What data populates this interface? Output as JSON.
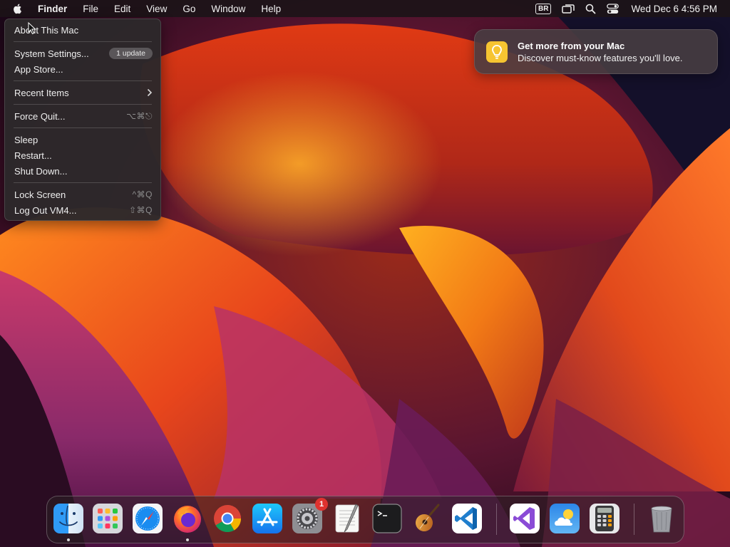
{
  "menubar": {
    "app_name": "Finder",
    "items": [
      "File",
      "Edit",
      "View",
      "Go",
      "Window",
      "Help"
    ],
    "input_source": "BR",
    "datetime": "Wed Dec 6  4:56 PM"
  },
  "apple_menu": {
    "about": "About This Mac",
    "system_settings": "System Settings...",
    "system_settings_badge": "1 update",
    "app_store": "App Store...",
    "recent_items": "Recent Items",
    "force_quit": "Force Quit...",
    "force_quit_shortcut": "⌥⌘⎋",
    "sleep": "Sleep",
    "restart": "Restart...",
    "shut_down": "Shut Down...",
    "lock_screen": "Lock Screen",
    "lock_screen_shortcut": "^⌘Q",
    "log_out": "Log Out VM4...",
    "log_out_shortcut": "⇧⌘Q"
  },
  "notification": {
    "title": "Get more from your Mac",
    "body": "Discover must-know features you'll love."
  },
  "dock": {
    "apps": [
      "finder",
      "launchpad",
      "safari",
      "firefox",
      "chrome",
      "app-store",
      "system-settings",
      "textedit",
      "terminal",
      "garageband",
      "vscode",
      "visual-studio",
      "weather",
      "calculator",
      "trash"
    ],
    "system_settings_badge": "1"
  },
  "colors": {
    "menu_bg": "#2c282a",
    "notification_bg": "#483e42",
    "badge_red": "#e0322f",
    "wallpaper_orange": "#f07a1e"
  }
}
